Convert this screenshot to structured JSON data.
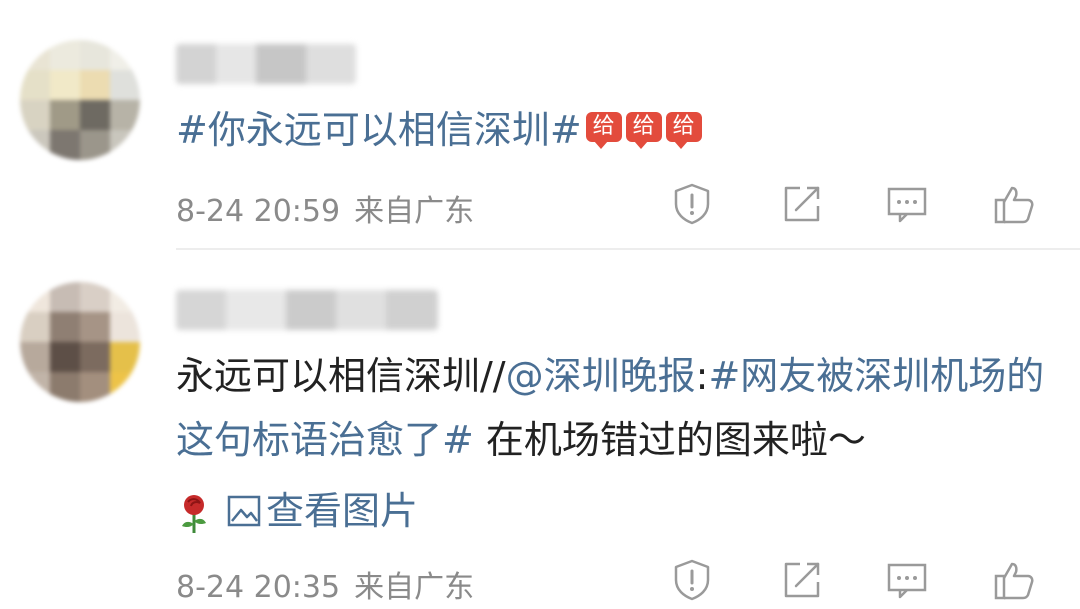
{
  "comments": [
    {
      "content": [
        {
          "text": "#你永远可以相信深圳#",
          "kind": "link"
        }
      ],
      "emoji_badges": [
        "给力",
        "给力",
        "给力"
      ],
      "timestamp": "8-24 20:59",
      "location": "来自广东"
    },
    {
      "content": [
        {
          "text": "永远可以相信深圳//",
          "kind": "text"
        },
        {
          "text": "@深圳晚报",
          "kind": "link"
        },
        {
          "text": ":",
          "kind": "text"
        },
        {
          "text": "#网友被深圳机场的这句标语治愈了#",
          "kind": "link"
        },
        {
          "text": " 在机场错过的图来啦～",
          "kind": "text"
        }
      ],
      "view_images_label": "查看图片",
      "timestamp": "8-24 20:35",
      "location": "来自广东"
    }
  ],
  "actions": [
    {
      "name": "report-icon"
    },
    {
      "name": "repost-icon"
    },
    {
      "name": "reply-icon"
    },
    {
      "name": "like-icon"
    }
  ],
  "colors": {
    "link": "#4a6f94",
    "meta": "#8a8a8a",
    "text": "#222222",
    "badge": "#e34b3c"
  }
}
